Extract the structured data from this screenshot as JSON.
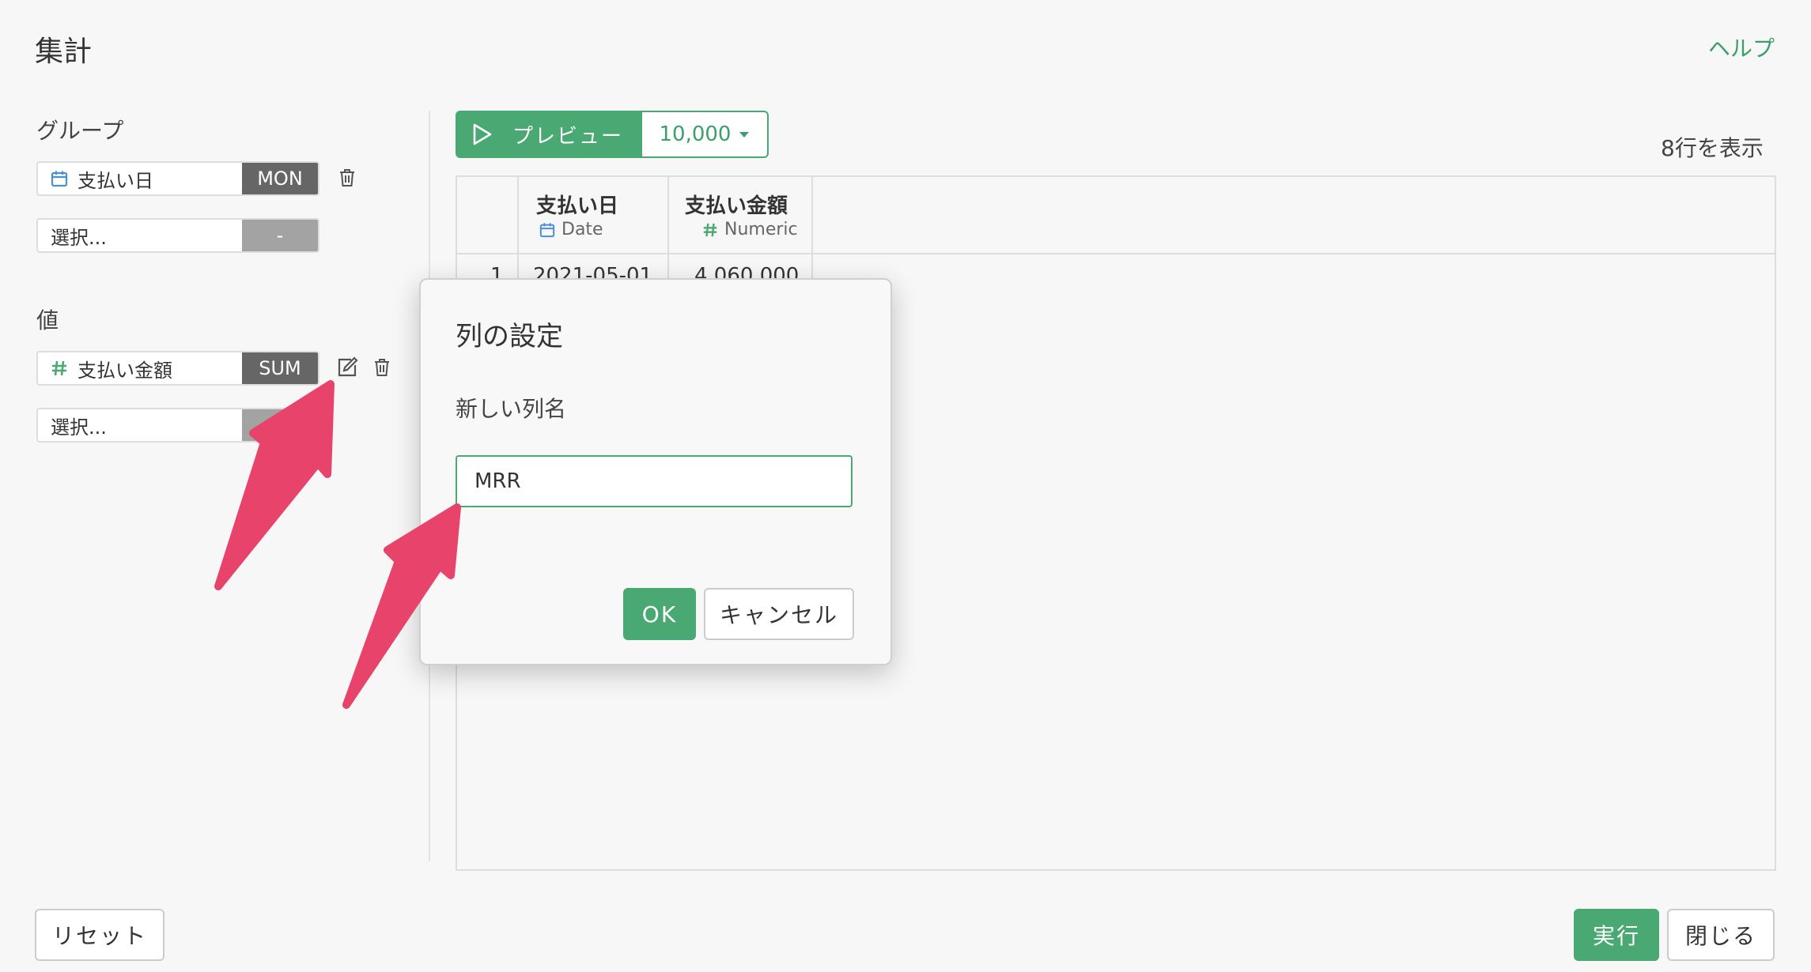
{
  "header": {
    "title": "集計",
    "help_link": "ヘルプ"
  },
  "sidebar": {
    "group_label": "グループ",
    "group_fields": [
      {
        "name": "支払い日",
        "agg": "MON",
        "icon": "calendar-icon"
      },
      {
        "name": "選択...",
        "agg": "-"
      }
    ],
    "value_label": "値",
    "value_fields": [
      {
        "name": "支払い金額",
        "agg": "SUM",
        "icon": "hash-icon"
      },
      {
        "name": "選択..."
      }
    ]
  },
  "preview": {
    "button_label": "プレビュー",
    "row_limit": "10,000",
    "row_count": "8行を表示"
  },
  "table": {
    "columns": [
      {
        "title": "支払い日",
        "type": "Date",
        "icon": "calendar-icon"
      },
      {
        "title": "支払い金額",
        "type": "Numeric",
        "icon": "hash-icon"
      }
    ],
    "rows": [
      {
        "index": "1",
        "cells": [
          "2021-05-01",
          "4,060,000"
        ]
      }
    ]
  },
  "modal": {
    "title": "列の設定",
    "field_label": "新しい列名",
    "field_value": "MRR",
    "ok_label": "OK",
    "cancel_label": "キャンセル"
  },
  "footer": {
    "reset_label": "リセット",
    "run_label": "実行",
    "close_label": "閉じる"
  },
  "colors": {
    "accent": "#4aa872",
    "annotation_arrow": "#e8436b",
    "agg_badge": "#666666"
  }
}
